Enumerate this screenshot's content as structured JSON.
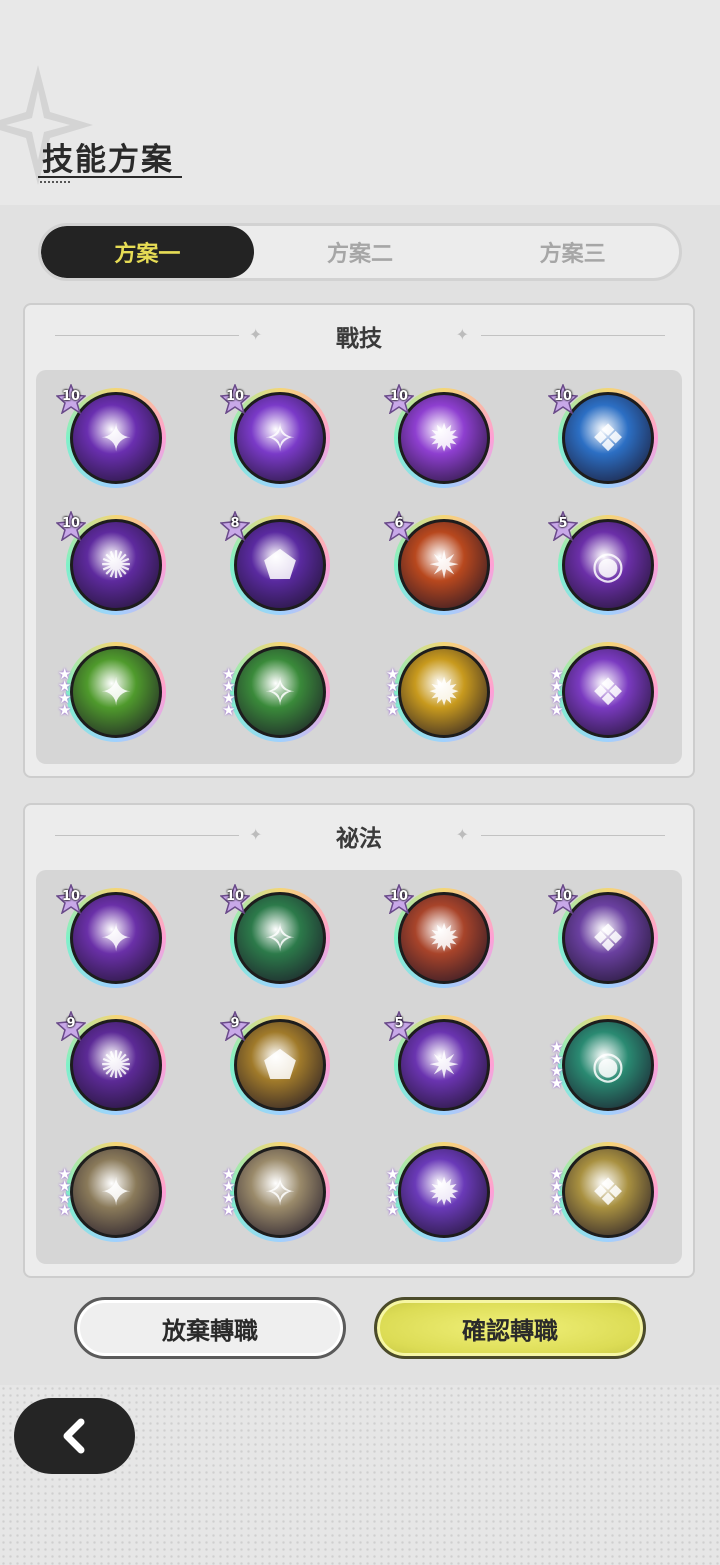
{
  "header": {
    "title": "技能方案"
  },
  "tabs": [
    {
      "label": "方案一",
      "active": true
    },
    {
      "label": "方案二",
      "active": false
    },
    {
      "label": "方案三",
      "active": false
    }
  ],
  "combat": {
    "title": "戰技",
    "skills": [
      {
        "level": "10",
        "stars": 0,
        "icon": "purple-star-burst-icon",
        "color": "#6a2fb0"
      },
      {
        "level": "10",
        "stars": 0,
        "icon": "purple-totem-icon",
        "color": "#7a3ac8"
      },
      {
        "level": "10",
        "stars": 0,
        "icon": "purple-shatter-icon",
        "color": "#8e3fd0"
      },
      {
        "level": "10",
        "stars": 0,
        "icon": "blue-frost-creature-icon",
        "color": "#2c6fc4"
      },
      {
        "level": "10",
        "stars": 0,
        "icon": "purple-rising-hand-icon",
        "color": "#5e2a9e"
      },
      {
        "level": "8",
        "stars": 0,
        "icon": "purple-shield-icon",
        "color": "#5a2aa0"
      },
      {
        "level": "6",
        "stars": 0,
        "icon": "orange-fire-golem-icon",
        "color": "#b8481e"
      },
      {
        "level": "5",
        "stars": 0,
        "icon": "purple-vortex-eye-icon",
        "color": "#6b2fa8"
      },
      {
        "level": "",
        "stars": 4,
        "icon": "green-tree-stump-icon",
        "color": "#4f9a2c"
      },
      {
        "level": "",
        "stars": 4,
        "icon": "green-slash-icon",
        "color": "#3a8a3a"
      },
      {
        "level": "",
        "stars": 4,
        "icon": "gold-sparkle-icon",
        "color": "#c89a1e"
      },
      {
        "level": "",
        "stars": 4,
        "icon": "purple-spiral-flower-icon",
        "color": "#7a3ac0"
      }
    ]
  },
  "arcana": {
    "title": "祕法",
    "skills": [
      {
        "level": "10",
        "stars": 0,
        "icon": "purple-eye-figure-icon",
        "color": "#6a30a8"
      },
      {
        "level": "10",
        "stars": 0,
        "icon": "green-healing-sparkle-icon",
        "color": "#2c7a4a"
      },
      {
        "level": "10",
        "stars": 0,
        "icon": "orange-crystal-burst-icon",
        "color": "#a8442a"
      },
      {
        "level": "10",
        "stars": 0,
        "icon": "purple-figure-arrows-icon",
        "color": "#6a40a0"
      },
      {
        "level": "9",
        "stars": 0,
        "icon": "purple-heart-figure-icon",
        "color": "#5c2a96"
      },
      {
        "level": "9",
        "stars": 0,
        "icon": "gold-figure-icon",
        "color": "#a07a2a"
      },
      {
        "level": "5",
        "stars": 0,
        "icon": "purple-flex-arm-icon",
        "color": "#6a34b0"
      },
      {
        "level": "",
        "stars": 4,
        "icon": "teal-meditate-figure-icon",
        "color": "#2a8a72"
      },
      {
        "level": "",
        "stars": 4,
        "icon": "beige-figure-icon",
        "color": "#8a7a5a"
      },
      {
        "level": "",
        "stars": 4,
        "icon": "beige-arrow-up-icon",
        "color": "#9a8a6a"
      },
      {
        "level": "",
        "stars": 4,
        "icon": "purple-crystals-icon",
        "color": "#6a3ab8"
      },
      {
        "level": "",
        "stars": 4,
        "icon": "gold-claw-icon",
        "color": "#a89040"
      }
    ]
  },
  "buttons": {
    "abandon": "放棄轉職",
    "confirm": "確認轉職"
  },
  "colors": {
    "tab_active_bg": "#232323",
    "tab_active_text": "#e6dc55",
    "confirm_button": "#dcdc55"
  }
}
